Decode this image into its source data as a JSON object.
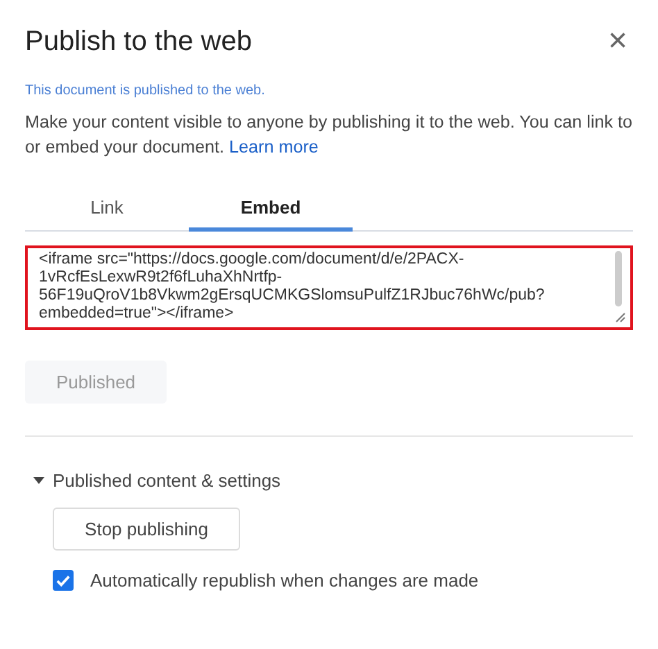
{
  "dialog": {
    "title": "Publish to the web",
    "close": "×"
  },
  "status": "This document is published to the web.",
  "description": {
    "text": "Make your content visible to anyone by publishing it to the web. You can link to or embed your document.",
    "link": "Learn more"
  },
  "tabs": [
    {
      "label": "Link",
      "selected": false
    },
    {
      "label": "Embed",
      "selected": true
    }
  ],
  "embed_code": {
    "lines": [
      "<iframe src=\"https://docs.google.com/document/d/e/2PACX-",
      "1vRcfEsLexwR9t2f6fLuhaXhNrtfp-",
      "56F19uQroV1b8Vkwm2gErsqUCMKGSlomsuPulfZ1RJbuc76hWc/pub?",
      "embedded=true\"></iframe>"
    ]
  },
  "publish_button": {
    "label": "Published",
    "disabled": true
  },
  "settings": {
    "label": "Published content & settings",
    "expanded": true,
    "stop_button": "Stop publishing",
    "auto_republish": {
      "label": "Automatically republish when changes are made",
      "checked": true
    }
  }
}
